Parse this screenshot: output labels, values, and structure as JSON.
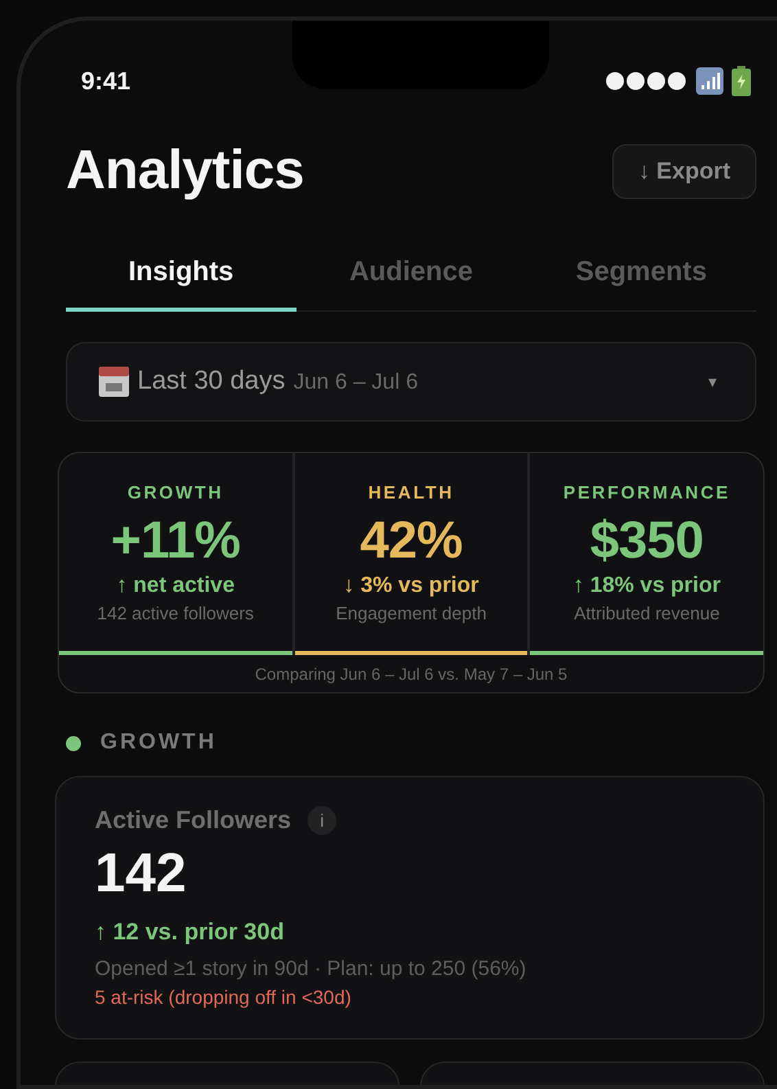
{
  "status_bar": {
    "time": "9:41"
  },
  "header": {
    "title": "Analytics",
    "export_button": "↓ Export"
  },
  "tabs": [
    {
      "label": "Insights",
      "selected": true
    },
    {
      "label": "Audience",
      "selected": false
    },
    {
      "label": "Segments",
      "selected": false
    }
  ],
  "date_range": {
    "label": "Last 30 days",
    "range": "Jun 6 – Jul 6",
    "caret": "▾"
  },
  "metrics": [
    {
      "title": "GROWTH",
      "value": "+11%",
      "change": "↑ net active",
      "caption": "142 active followers",
      "color": "#7bc67b"
    },
    {
      "title": "HEALTH",
      "value": "42%",
      "change": "↓ 3% vs prior",
      "caption": "Engagement depth",
      "color": "#e6b85c"
    },
    {
      "title": "PERFORMANCE",
      "value": "$350",
      "change": "↑ 18% vs prior",
      "caption": "Attributed revenue",
      "color": "#7bc67b"
    }
  ],
  "comparison": "Comparing Jun 6 – Jul 6 vs. May 7 – Jun 5",
  "section": {
    "title": "GROWTH",
    "color": "#7bc67b"
  },
  "follower_card": {
    "title": "Active Followers",
    "info": "i",
    "value": "142",
    "change": "↑ 12 vs. prior 30d",
    "detail": "Opened ≥1 story in 90d · Plan: up to 250 (56%)",
    "warning": "5 at-risk (dropping off in <30d)"
  }
}
